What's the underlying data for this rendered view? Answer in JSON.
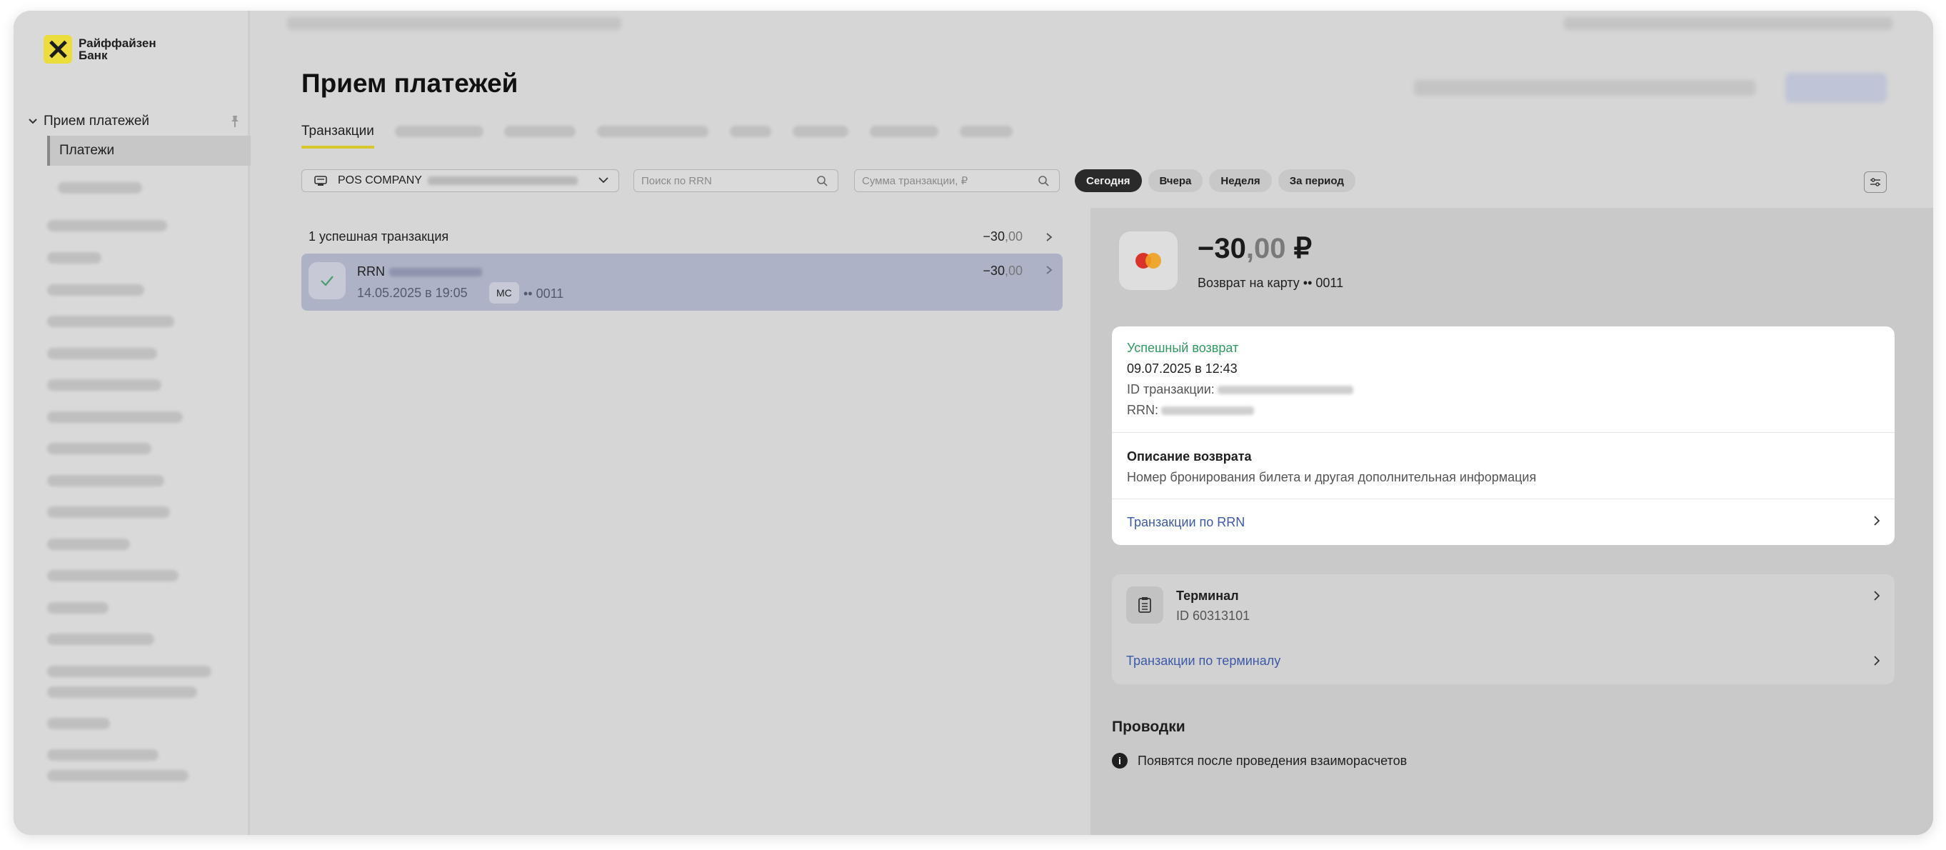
{
  "brand": {
    "name": "Райффайзен Банк"
  },
  "sidebar": {
    "section_title": "Прием платежей",
    "active_item": "Платежи"
  },
  "main": {
    "title": "Прием платежей",
    "active_tab": "Транзакции"
  },
  "filters": {
    "terminal_select": "POS COMPANY",
    "rrn_placeholder": "Поиск по RRN",
    "amount_placeholder": "Сумма транзакции, ₽",
    "periods": [
      "Сегодня",
      "Вчера",
      "Неделя",
      "За период"
    ],
    "selected_period": "Сегодня"
  },
  "transactions": {
    "summary_label": "1 успешная транзакция",
    "summary_amount_int": "−30",
    "summary_amount_dec": ",00",
    "items": [
      {
        "rrn_label": "RRN",
        "datetime": "14.05.2025 в 19:05",
        "card_type": "MC",
        "card_mask": "•• 0011",
        "amount_int": "−30",
        "amount_dec": ",00",
        "status": "success"
      }
    ]
  },
  "detail": {
    "amount_int": "−30",
    "amount_dec": ",00",
    "currency": " ₽",
    "refund_line": "Возврат на карту •• 0011",
    "status": "Успешный возврат",
    "datetime": "09.07.2025 в 12:43",
    "transaction_id_label": "ID транзакции:",
    "rrn_label": "RRN:",
    "description_title": "Описание возврата",
    "description": "Номер бронирования  билета и другая дополнительная информация",
    "rrn_link": "Транзакции по RRN",
    "terminal_title": "Терминал",
    "terminal_id": "ID 60313101",
    "terminal_link": "Транзакции по терминалу",
    "postings_title": "Проводки",
    "postings_info": "Появятся после проведения взаиморасчетов"
  },
  "colors": {
    "accent_yellow": "#d8c72c",
    "link_blue": "#3d5aa8",
    "success_green": "#2e9a62",
    "selected_row": "#aeb2c6"
  }
}
